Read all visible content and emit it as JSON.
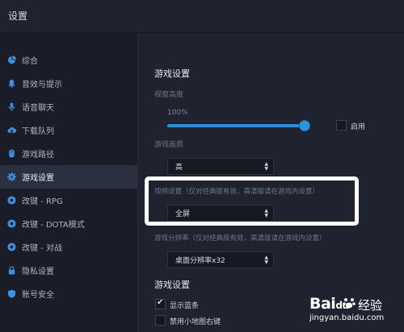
{
  "window": {
    "title": "设置"
  },
  "sidebar": {
    "items": [
      {
        "label": "综合",
        "icon": "pie-chart-icon"
      },
      {
        "label": "音效与提示",
        "icon": "bell-icon"
      },
      {
        "label": "语音聊天",
        "icon": "microphone-icon"
      },
      {
        "label": "下载队列",
        "icon": "cloud-download-icon"
      },
      {
        "label": "游戏路径",
        "icon": "mouse-icon"
      },
      {
        "label": "游戏设置",
        "icon": "gear-icon",
        "active": true
      },
      {
        "label": "改键 - RPG",
        "icon": "gamepad-icon"
      },
      {
        "label": "改键 - DOTA模式",
        "icon": "gamepad-icon"
      },
      {
        "label": "改键 - 对战",
        "icon": "gamepad-icon"
      },
      {
        "label": "隐私设置",
        "icon": "lock-icon"
      },
      {
        "label": "账号安全",
        "icon": "shield-icon"
      }
    ]
  },
  "main": {
    "section_title": "游戏设置",
    "brightness": {
      "label": "视窗高度",
      "value_text": "100%",
      "value": 1.0,
      "toggle_label": "启用",
      "toggle_checked": false
    },
    "quality": {
      "label": "游戏画质",
      "selected": "高"
    },
    "video": {
      "label": "视频设置（仅对经典版有效，高清版请在游戏内设置）",
      "selected": "全屏"
    },
    "resolution": {
      "label": "游戏分辨率（仅对经典版有效，高清版请在游戏内设置）",
      "selected": "桌面分辨率x32"
    },
    "section2_title": "游戏设置",
    "options": [
      {
        "label": "显示蓝条",
        "checked": true
      },
      {
        "label": "禁用小地图右键",
        "checked": false
      }
    ]
  },
  "watermark": {
    "logo": "Bai",
    "logo_suffix": "du",
    "brand": "经验",
    "url": "jingyan.baidu.com"
  },
  "colors": {
    "accent": "#2c8fd6",
    "sidebar_active": "#2b3040",
    "highlight": "#ffffff"
  }
}
